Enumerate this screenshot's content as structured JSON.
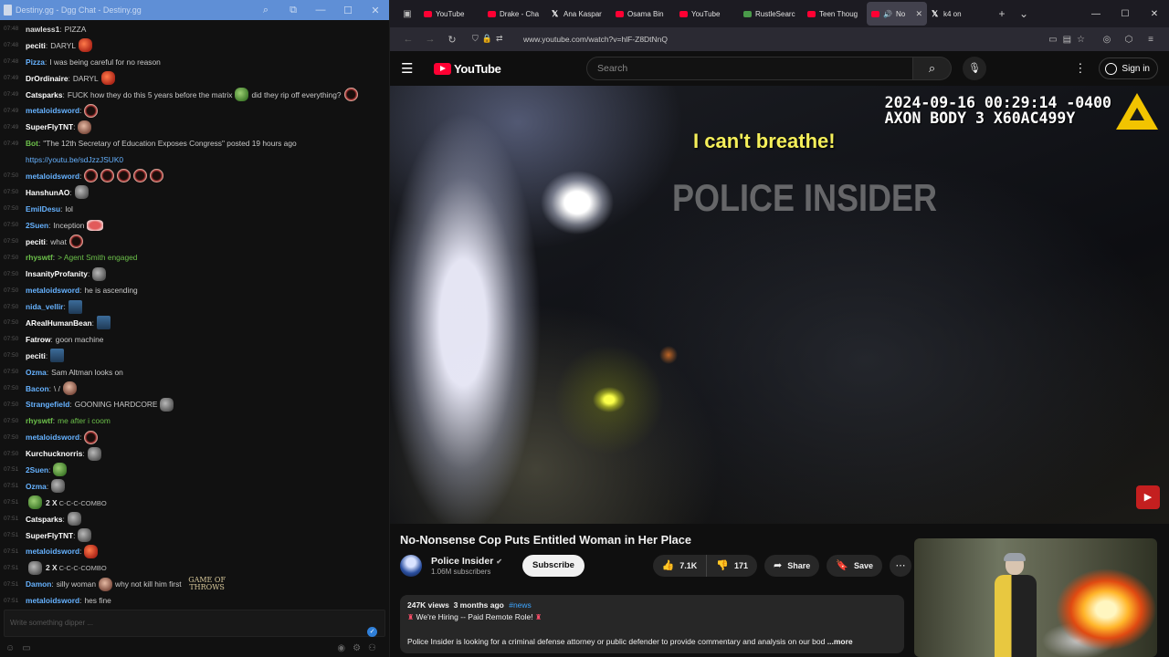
{
  "chat_window": {
    "title": "Destiny.gg - Dgg Chat - Destiny.gg",
    "messages": [
      {
        "time": "07:48",
        "user": "nawless1",
        "user_color": "#dcdcdc",
        "text": "PIZZA",
        "emotes": []
      },
      {
        "time": "07:48",
        "user": "peciti",
        "user_color": "#ffffff",
        "text": "DARYL",
        "emotes": [
          "red-face-emote"
        ]
      },
      {
        "time": "07:48",
        "user": "Pizza",
        "user_color": "#66b2ff",
        "text": "I was being careful for no reason",
        "emotes": []
      },
      {
        "time": "07:49",
        "user": "DrOrdinaire",
        "user_color": "#ffffff",
        "text": "DARYL",
        "emotes": [
          "red-face-emote"
        ]
      },
      {
        "time": "07:49",
        "user": "Catsparks",
        "user_color": "#ffffff",
        "text": "FUCK how they do this 5 years before the matrix",
        "text2": "did they rip off everything?",
        "emotes": [
          "pepe-emote",
          "ring-emote"
        ]
      },
      {
        "time": "07:49",
        "user": "metaloidsword",
        "user_color": "#66b2ff",
        "text": "",
        "emotes": [
          "ring-emote"
        ]
      },
      {
        "time": "07:49",
        "user": "SuperFlyTNT",
        "user_color": "#ffffff",
        "text": "",
        "emotes": [
          "face-emote"
        ]
      },
      {
        "time": "07:49",
        "user": "Bot",
        "user_color": "#6cc04a",
        "text": "\"The 12th Secretary of Education Exposes Congress\" posted 19 hours ago",
        "emotes": []
      },
      {
        "time": "",
        "user": "",
        "user_color": "#66b2ff",
        "text": "https://youtu.be/sdJzzJSUK0",
        "emotes": []
      },
      {
        "time": "07:50",
        "user": "metaloidsword",
        "user_color": "#66b2ff",
        "text": "",
        "emotes": [
          "ring-emote",
          "ring-emote",
          "ring-emote",
          "ring-emote",
          "ring-emote"
        ]
      },
      {
        "time": "07:50",
        "user": "HanshunAO",
        "user_color": "#ffffff",
        "text": "",
        "emotes": [
          "grey-emote"
        ]
      },
      {
        "time": "07:50",
        "user": "EmilDesu",
        "user_color": "#66b2ff",
        "text": "lol",
        "emotes": []
      },
      {
        "time": "07:50",
        "user": "2Suen",
        "user_color": "#66b2ff",
        "text": "Inception",
        "emotes": [
          "lips-emote"
        ]
      },
      {
        "time": "07:50",
        "user": "peciti",
        "user_color": "#ffffff",
        "text": "what",
        "emotes": [
          "ring-emote"
        ]
      },
      {
        "time": "07:50",
        "user": "rhyswtf",
        "user_color": "#6cc04a",
        "text": "> Agent Smith engaged",
        "emotes": []
      },
      {
        "time": "07:50",
        "user": "InsanityProfanity",
        "user_color": "#ffffff",
        "text": "",
        "emotes": [
          "grey-emote"
        ]
      },
      {
        "time": "07:50",
        "user": "metaloidsword",
        "user_color": "#66b2ff",
        "text": "he is ascending",
        "emotes": []
      },
      {
        "time": "07:50",
        "user": "nida_vellir",
        "user_color": "#66b2ff",
        "text": "",
        "emotes": [
          "blue-emote"
        ]
      },
      {
        "time": "07:50",
        "user": "ARealHumanBean",
        "user_color": "#ffffff",
        "text": "",
        "emotes": [
          "blue-emote"
        ]
      },
      {
        "time": "07:50",
        "user": "Fatrow",
        "user_color": "#ffffff",
        "text": "goon machine",
        "emotes": []
      },
      {
        "time": "07:50",
        "user": "peciti",
        "user_color": "#ffffff",
        "text": "",
        "emotes": [
          "blue-emote"
        ]
      },
      {
        "time": "07:50",
        "user": "Ozma",
        "user_color": "#66b2ff",
        "text": "Sam Altman looks on",
        "emotes": []
      },
      {
        "time": "07:50",
        "user": "Bacon",
        "user_color": "#66b2ff",
        "text": "\\ /",
        "emotes": [
          "face-emote"
        ]
      },
      {
        "time": "07:50",
        "user": "Strangefield",
        "user_color": "#66b2ff",
        "text": "GOONING HARDCORE",
        "emotes": [
          "grey-emote"
        ]
      },
      {
        "time": "07:50",
        "user": "rhyswtf",
        "user_color": "#6cc04a",
        "text": "me after i coom",
        "emotes": []
      },
      {
        "time": "07:50",
        "user": "metaloidsword",
        "user_color": "#66b2ff",
        "text": "",
        "emotes": [
          "ring-emote"
        ]
      },
      {
        "time": "07:50",
        "user": "Kurchucknorris",
        "user_color": "#ffffff",
        "text": "",
        "emotes": [
          "grey-emote"
        ]
      },
      {
        "time": "07:51",
        "user": "2Suen",
        "user_color": "#66b2ff",
        "text": "",
        "emotes": [
          "green-emote"
        ]
      },
      {
        "time": "07:51",
        "user": "Ozma",
        "user_color": "#66b2ff",
        "text": "",
        "emotes": [
          "grey-emote"
        ]
      },
      {
        "time": "07:51",
        "user": "",
        "user_color": "#ffffff",
        "text": "",
        "combo": "2 X",
        "combo_text": "C-C-C-COMBO",
        "emotes": [
          "green-emote"
        ]
      },
      {
        "time": "07:51",
        "user": "Catsparks",
        "user_color": "#ffffff",
        "text": "",
        "emotes": [
          "grey-emote"
        ]
      },
      {
        "time": "07:51",
        "user": "SuperFlyTNT",
        "user_color": "#ffffff",
        "text": "",
        "emotes": [
          "grey-emote"
        ]
      },
      {
        "time": "07:51",
        "user": "metaloidsword",
        "user_color": "#66b2ff",
        "text": "",
        "emotes": [
          "red-face-emote"
        ]
      },
      {
        "time": "07:51",
        "user": "",
        "user_color": "#ffffff",
        "text": "",
        "combo": "2 X",
        "combo_text": "C-C-C-COMBO",
        "emotes": [
          "grey-emote"
        ]
      },
      {
        "time": "07:51",
        "user": "Damon",
        "user_color": "#66b2ff",
        "text": "silly woman",
        "text2": "why not kill him first",
        "emotes": [
          "face-emote"
        ],
        "got": "GAME OF THROWS"
      },
      {
        "time": "07:51",
        "user": "metaloidsword",
        "user_color": "#66b2ff",
        "text": "hes fine",
        "emotes": []
      }
    ],
    "input_placeholder": "Write something dipper ...",
    "footer_icons": [
      "smiley-icon",
      "chat-bubbles-icon",
      "eye-icon",
      "gear-icon",
      "users-icon"
    ]
  },
  "browser": {
    "tabs": [
      {
        "label": "YouTube",
        "favicon": "yt"
      },
      {
        "label": "Drake - Cha",
        "favicon": "yt"
      },
      {
        "label": "Ana Kaspar",
        "favicon": "x"
      },
      {
        "label": "Osama Bin",
        "favicon": "yt"
      },
      {
        "label": "YouTube",
        "favicon": "yt"
      },
      {
        "label": "RustleSearc",
        "favicon": "gr"
      },
      {
        "label": "Teen Thoug",
        "favicon": "yt"
      },
      {
        "label": "No",
        "favicon": "yt",
        "active": true
      },
      {
        "label": "k4 on",
        "favicon": "x"
      }
    ],
    "url": "www.youtube.com/watch?v=hlF-Z8DtNnQ"
  },
  "youtube": {
    "logo_text": "YouTube",
    "search_placeholder": "Search",
    "sign_in": "Sign in",
    "video": {
      "timestamp_line1": "2024-09-16 00:29:14 -0400",
      "timestamp_line2": "AXON BODY 3 X60AC499Y",
      "caption": "I can't breathe!",
      "watermark": "POLICE INSIDER"
    },
    "title": "No-Nonsense Cop Puts Entitled Woman in Her Place",
    "channel": {
      "name": "Police Insider",
      "subscribers": "1.06M subscribers"
    },
    "subscribe": "Subscribe",
    "likes": "7.1K",
    "dislikes": "171",
    "share": "Share",
    "save": "Save",
    "description": {
      "views": "247K views",
      "age": "3 months ago",
      "tag": "#news",
      "line1": "We're Hiring -- Paid Remote Role!",
      "line2": "Police Insider is looking for a criminal defense attorney or public defender to provide commentary and analysis on our bod",
      "more": "...more"
    }
  }
}
